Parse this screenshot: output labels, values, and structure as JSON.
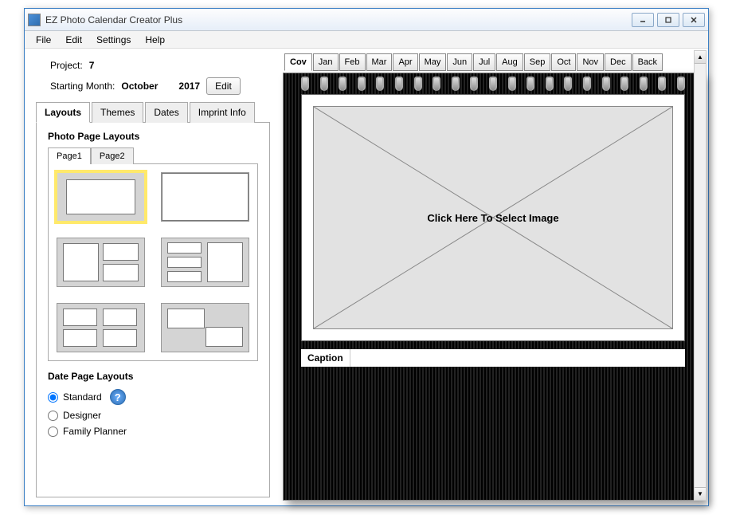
{
  "window": {
    "title": "EZ Photo Calendar Creator Plus"
  },
  "menubar": [
    "File",
    "Edit",
    "Settings",
    "Help"
  ],
  "project": {
    "label": "Project:",
    "value": "7"
  },
  "starting": {
    "label": "Starting Month:",
    "month": "October",
    "year": "2017",
    "edit": "Edit"
  },
  "mainTabs": [
    "Layouts",
    "Themes",
    "Dates",
    "Imprint Info"
  ],
  "photoLayouts": {
    "title": "Photo Page Layouts",
    "subtabs": [
      "Page1",
      "Page2"
    ]
  },
  "dateLayouts": {
    "title": "Date Page Layouts",
    "options": [
      "Standard",
      "Designer",
      "Family Planner"
    ],
    "selected": "Standard"
  },
  "monthTabs": [
    "Cov",
    "Jan",
    "Feb",
    "Mar",
    "Apr",
    "May",
    "Jun",
    "Jul",
    "Aug",
    "Sep",
    "Oct",
    "Nov",
    "Dec",
    "Back"
  ],
  "placeholder": "Click Here To Select Image",
  "caption": {
    "label": "Caption",
    "value": ""
  }
}
